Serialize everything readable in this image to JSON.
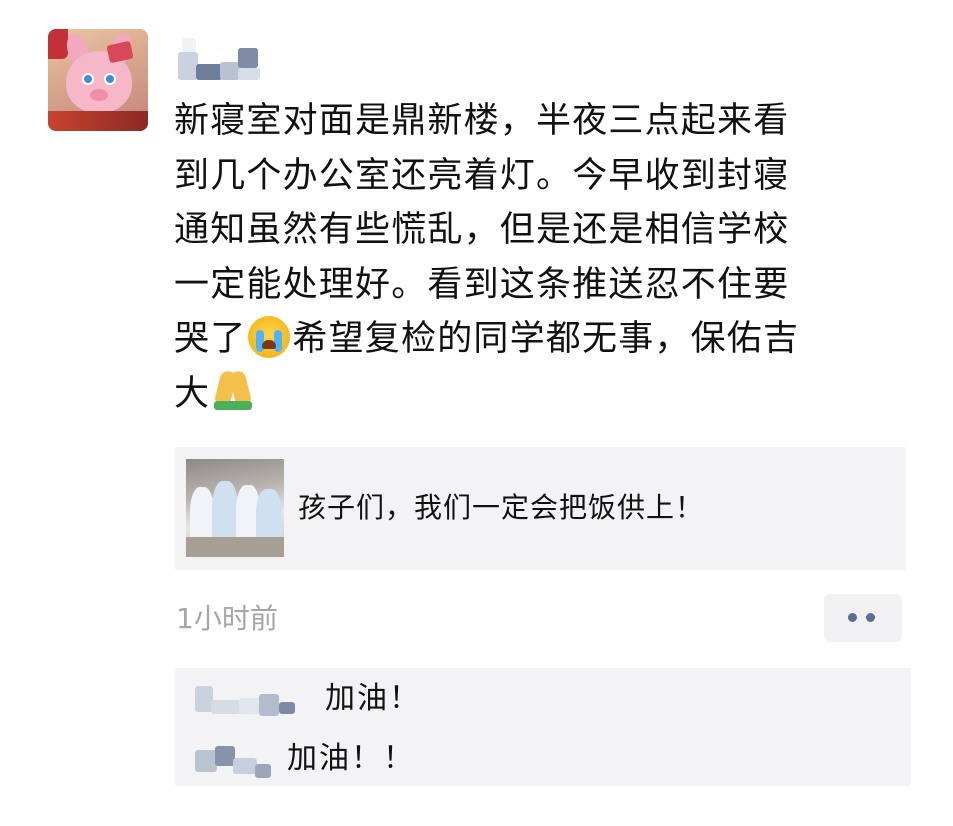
{
  "post": {
    "author_name": "",
    "text_lines": [
      "新寝室对面是鼎新楼，半夜三点起来看",
      "到几个办公室还亮着灯。今早收到封寝",
      "通知虽然有些慌乱，但是还是相信学校",
      "一定能处理好。看到这条推送忍不住要"
    ],
    "line5_before_emoji": "哭了",
    "line5_after_emoji": "希望复检的同学都无事，保佑吉",
    "line6_text": "大",
    "emoji_1": "crying-face-emoji",
    "emoji_2": "folded-hands-emoji",
    "time_ago": "1小时前"
  },
  "link_card": {
    "title": "孩子们，我们一定会把饭供上！"
  },
  "comments": [
    {
      "author": "",
      "text": "加油！"
    },
    {
      "author": "",
      "text": "加油！！"
    }
  ],
  "colors": {
    "text": "#111111",
    "muted": "#a6a6a6",
    "card_bg": "#f3f3f5",
    "more_dots": "#5a6f93"
  }
}
